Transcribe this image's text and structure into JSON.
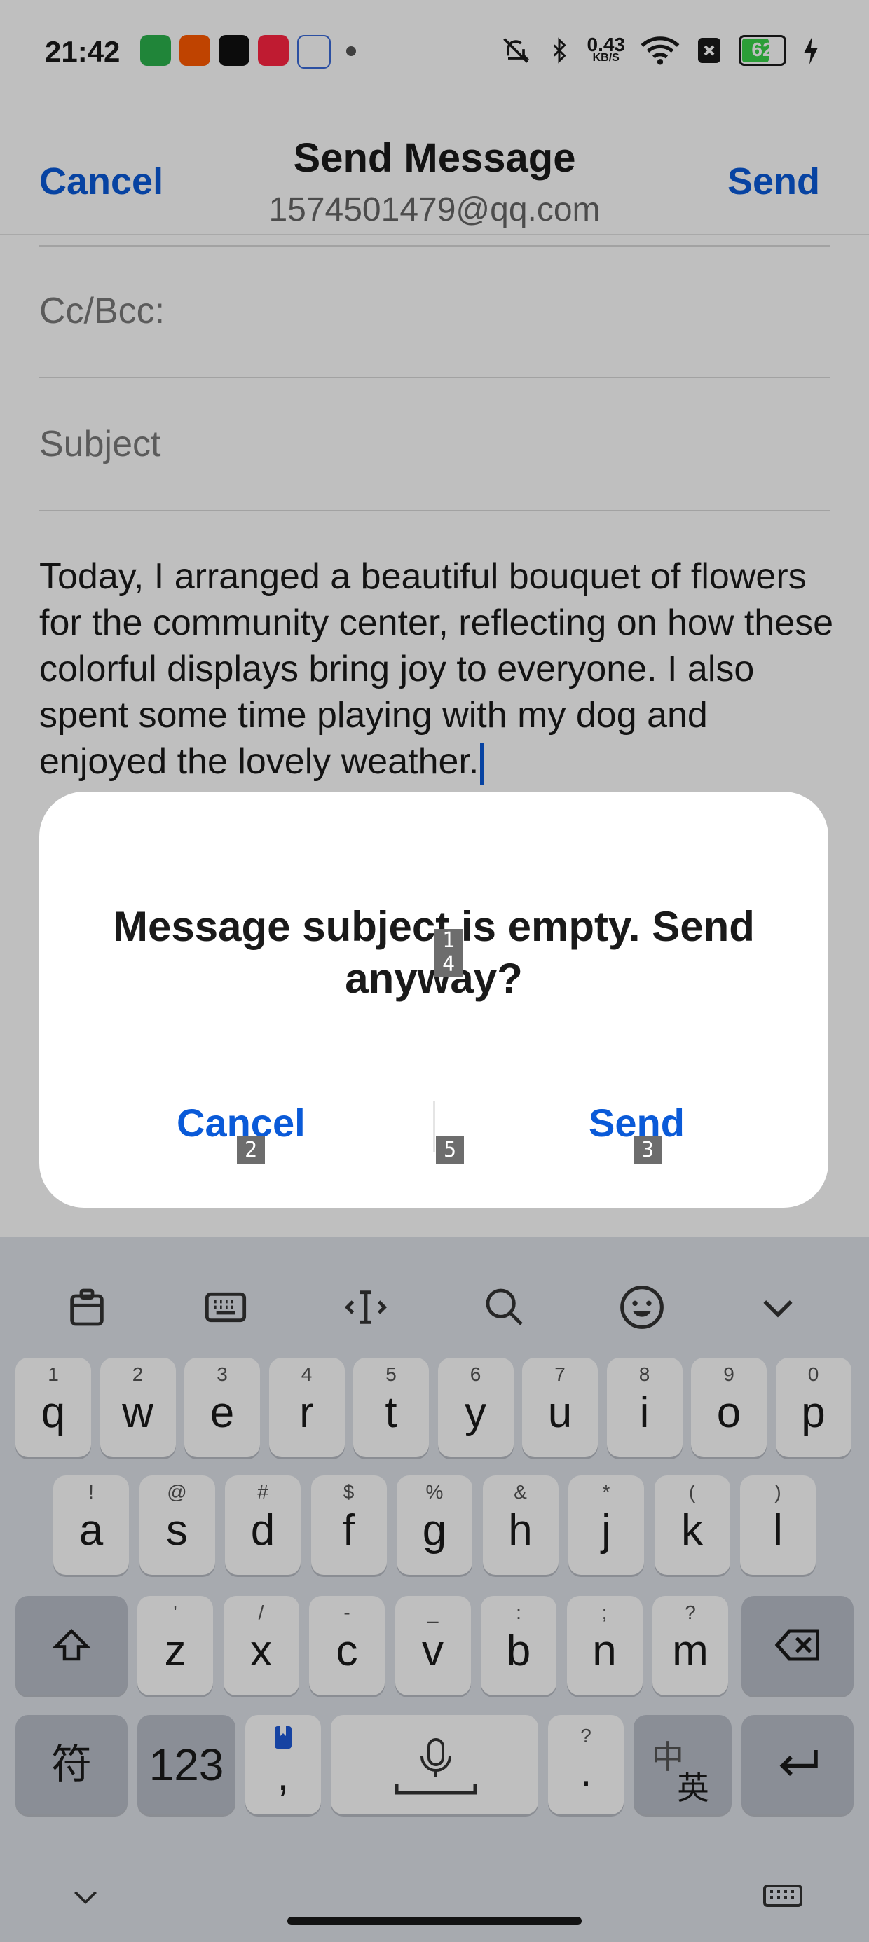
{
  "status_bar": {
    "time": "21:42",
    "network_speed": "0.43",
    "network_unit": "KB/S",
    "battery": "62",
    "app_icons": [
      "wechat-icon",
      "taobao-icon",
      "tiktok-icon",
      "xiaohongshu-icon",
      "gmail-icon"
    ]
  },
  "header": {
    "cancel_label": "Cancel",
    "title": "Send Message",
    "subtitle": "1574501479@qq.com",
    "send_label": "Send"
  },
  "fields": {
    "cc_bcc_label": "Cc/Bcc:",
    "subject_placeholder": "Subject",
    "body": "Today, I arranged a beautiful bouquet of flowers for the community center, reflecting on how these colorful displays bring joy to everyone. I also spent some time playing with my dog and enjoyed the lovely weather."
  },
  "dialog": {
    "message": "Message subject is empty. Send anyway?",
    "cancel_label": "Cancel",
    "send_label": "Send",
    "markers": [
      "1",
      "4",
      "2",
      "5",
      "3"
    ]
  },
  "keyboard": {
    "row1": [
      {
        "sup": "1",
        "key": "q"
      },
      {
        "sup": "2",
        "key": "w"
      },
      {
        "sup": "3",
        "key": "e"
      },
      {
        "sup": "4",
        "key": "r"
      },
      {
        "sup": "5",
        "key": "t"
      },
      {
        "sup": "6",
        "key": "y"
      },
      {
        "sup": "7",
        "key": "u"
      },
      {
        "sup": "8",
        "key": "i"
      },
      {
        "sup": "9",
        "key": "o"
      },
      {
        "sup": "0",
        "key": "p"
      }
    ],
    "row2": [
      {
        "sup": "!",
        "key": "a"
      },
      {
        "sup": "@",
        "key": "s"
      },
      {
        "sup": "#",
        "key": "d"
      },
      {
        "sup": "$",
        "key": "f"
      },
      {
        "sup": "%",
        "key": "g"
      },
      {
        "sup": "&",
        "key": "h"
      },
      {
        "sup": "*",
        "key": "j"
      },
      {
        "sup": "(",
        "key": "k"
      },
      {
        "sup": ")",
        "key": "l"
      }
    ],
    "row3": [
      {
        "sup": "'",
        "key": "z"
      },
      {
        "sup": "/",
        "key": "x"
      },
      {
        "sup": "-",
        "key": "c"
      },
      {
        "sup": "_",
        "key": "v"
      },
      {
        "sup": ":",
        "key": "b"
      },
      {
        "sup": ";",
        "key": "n"
      },
      {
        "sup": "?",
        "key": "m"
      }
    ],
    "row4": {
      "symbols_label": "符",
      "numbers_label": "123",
      "comma": ",",
      "period_sup": "?",
      "period": ".",
      "lang_zh": "中",
      "lang_en": "英"
    }
  }
}
